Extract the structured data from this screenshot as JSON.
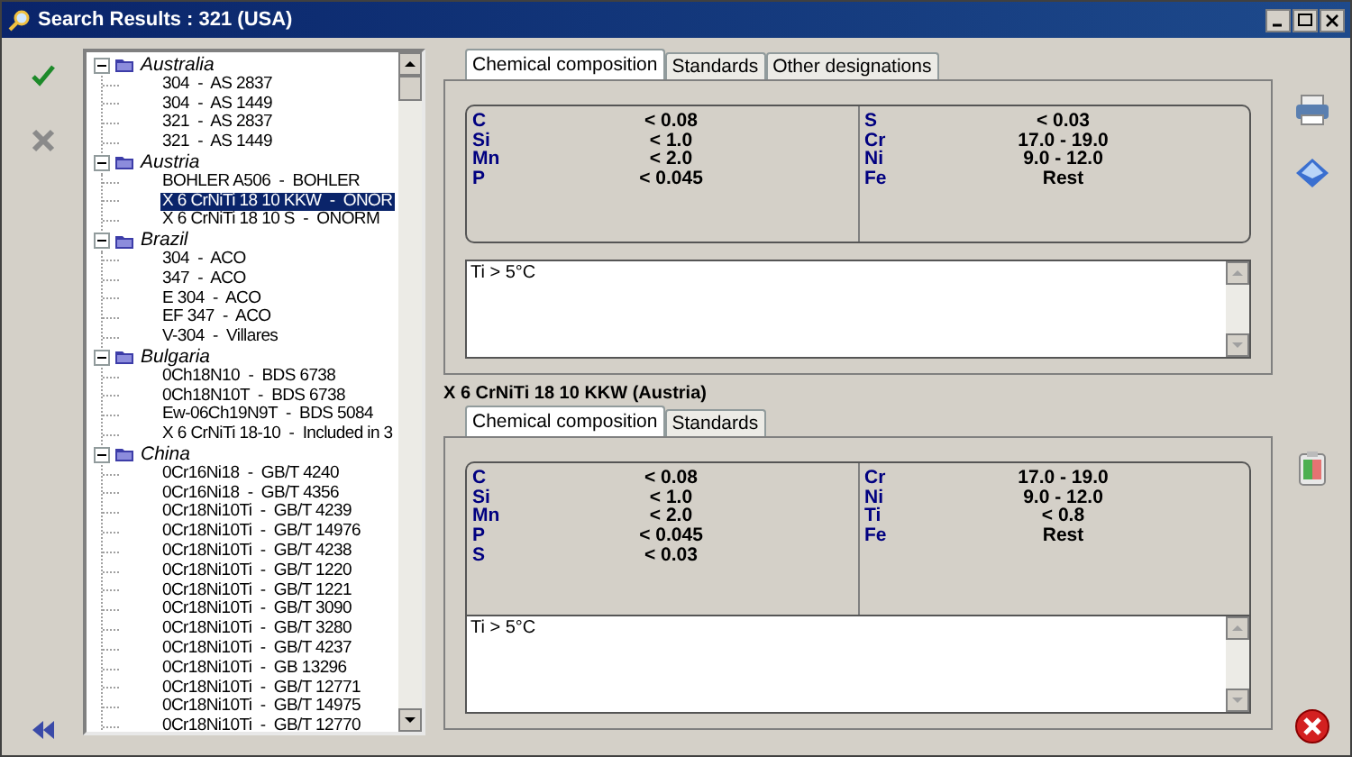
{
  "window": {
    "title": "Search Results : 321 (USA)"
  },
  "tree": [
    {
      "label": "Australia",
      "expanded": true,
      "children": [
        {
          "label": "304  -  AS 2837",
          "selected": false
        },
        {
          "label": "304  -  AS 1449",
          "selected": false
        },
        {
          "label": "321  -  AS 2837",
          "selected": false
        },
        {
          "label": "321  -  AS 1449",
          "selected": false
        }
      ]
    },
    {
      "label": "Austria",
      "expanded": true,
      "children": [
        {
          "label": "BOHLER A506  -  BOHLER",
          "selected": false
        },
        {
          "label": "X 6 CrNiTi 18 10 KKW  -  ONOR",
          "selected": true
        },
        {
          "label": "X 6 CrNiTi 18 10 S  -  ONORM",
          "selected": false
        }
      ]
    },
    {
      "label": "Brazil",
      "expanded": true,
      "children": [
        {
          "label": "304  -  ACO",
          "selected": false
        },
        {
          "label": "347  -  ACO",
          "selected": false
        },
        {
          "label": "E 304  -  ACO",
          "selected": false
        },
        {
          "label": "EF 347  -  ACO",
          "selected": false
        },
        {
          "label": "V-304  -  Villares",
          "selected": false
        }
      ]
    },
    {
      "label": "Bulgaria",
      "expanded": true,
      "children": [
        {
          "label": "0Ch18N10  -  BDS 6738",
          "selected": false
        },
        {
          "label": "0Ch18N10T  -  BDS 6738",
          "selected": false
        },
        {
          "label": "Ew-06Ch19N9T  -  BDS 5084",
          "selected": false
        },
        {
          "label": "X 6 CrNiTi 18-10  -  Included in 3",
          "selected": false
        }
      ]
    },
    {
      "label": "China",
      "expanded": true,
      "children": [
        {
          "label": "0Cr16Ni18  -  GB/T 4240",
          "selected": false
        },
        {
          "label": "0Cr16Ni18  -  GB/T 4356",
          "selected": false
        },
        {
          "label": "0Cr18Ni10Ti  -  GB/T 4239",
          "selected": false
        },
        {
          "label": "0Cr18Ni10Ti  -  GB/T 14976",
          "selected": false
        },
        {
          "label": "0Cr18Ni10Ti  -  GB/T 4238",
          "selected": false
        },
        {
          "label": "0Cr18Ni10Ti  -  GB/T 1220",
          "selected": false
        },
        {
          "label": "0Cr18Ni10Ti  -  GB/T 1221",
          "selected": false
        },
        {
          "label": "0Cr18Ni10Ti  -  GB/T 3090",
          "selected": false
        },
        {
          "label": "0Cr18Ni10Ti  -  GB/T 3280",
          "selected": false
        },
        {
          "label": "0Cr18Ni10Ti  -  GB/T 4237",
          "selected": false
        },
        {
          "label": "0Cr18Ni10Ti  -  GB 13296",
          "selected": false
        },
        {
          "label": "0Cr18Ni10Ti  -  GB/T 12771",
          "selected": false
        },
        {
          "label": "0Cr18Ni10Ti  -  GB/T 14975",
          "selected": false
        },
        {
          "label": "0Cr18Ni10Ti  -  GB/T 12770",
          "selected": false
        }
      ]
    }
  ],
  "search_material": {
    "tabs": [
      {
        "label": "Chemical composition",
        "selected": true
      },
      {
        "label": "Standards",
        "selected": false
      },
      {
        "label": "Other designations",
        "selected": false
      }
    ],
    "composition_left": [
      {
        "element": "C",
        "value": "< 0.08"
      },
      {
        "element": "Si",
        "value": "< 1.0"
      },
      {
        "element": "Mn",
        "value": "< 2.0"
      },
      {
        "element": "P",
        "value": "< 0.045"
      }
    ],
    "composition_right": [
      {
        "element": "S",
        "value": "< 0.03"
      },
      {
        "element": "Cr",
        "value": "17.0 - 19.0"
      },
      {
        "element": "Ni",
        "value": "9.0 - 12.0"
      },
      {
        "element": "Fe",
        "value": "Rest"
      }
    ],
    "notes": "Ti > 5°C"
  },
  "selected_heading": "X 6 CrNiTi 18 10 KKW (Austria)",
  "selected_material": {
    "tabs": [
      {
        "label": "Chemical composition",
        "selected": true
      },
      {
        "label": "Standards",
        "selected": false
      }
    ],
    "composition_left": [
      {
        "element": "C",
        "value": "< 0.08"
      },
      {
        "element": "Si",
        "value": "< 1.0"
      },
      {
        "element": "Mn",
        "value": "< 2.0"
      },
      {
        "element": "P",
        "value": "< 0.045"
      },
      {
        "element": "S",
        "value": "< 0.03"
      }
    ],
    "composition_right": [
      {
        "element": "Cr",
        "value": "17.0 - 19.0"
      },
      {
        "element": "Ni",
        "value": "9.0 - 12.0"
      },
      {
        "element": "Ti",
        "value": "< 0.8"
      },
      {
        "element": "Fe",
        "value": "Rest"
      }
    ],
    "notes": "Ti > 5°C"
  }
}
